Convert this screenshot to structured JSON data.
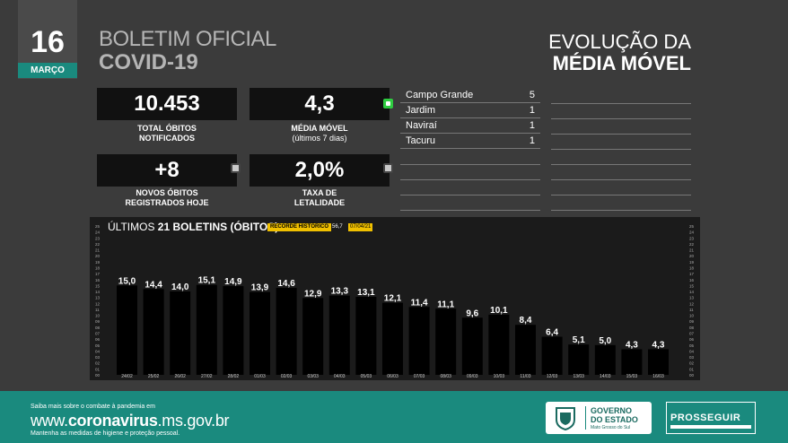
{
  "header": {
    "day": "16",
    "month": "MARÇO",
    "title_line1": "BOLETIM OFICIAL",
    "title_line2": "COVID-19",
    "evo_line1": "EVOLUÇÃO DA",
    "evo_line2": "MÉDIA MÓVEL"
  },
  "stats": {
    "total_obitos": {
      "value": "10.453",
      "label1": "TOTAL ÓBITOS",
      "label2": "NOTIFICADOS"
    },
    "media_movel": {
      "value": "4,3",
      "label1": "MÉDIA MÓVEL",
      "label2": "(últimos 7 dias)",
      "indicator": "green"
    },
    "novos_obitos": {
      "value": "+8",
      "label1": "NOVOS ÓBITOS",
      "label2": "REGISTRADOS HOJE",
      "indicator": "grey"
    },
    "letalidade": {
      "value": "2,0%",
      "label1": "TAXA DE",
      "label2": "LETALIDADE",
      "indicator": "grey"
    }
  },
  "cities": [
    {
      "name": "Campo Grande",
      "value": "5"
    },
    {
      "name": "Jardim",
      "value": "1"
    },
    {
      "name": "Naviraí",
      "value": "1"
    },
    {
      "name": "Tacuru",
      "value": "1"
    }
  ],
  "chart_header": {
    "title_pre": "ÚLTIMOS ",
    "title_bold": "21 BOLETINS (ÓBITOS)",
    "record_label": "RECORDE HISTÓRICO",
    "record_value": "56,7",
    "record_date": "07/04/21"
  },
  "chart_data": {
    "type": "bar",
    "title": "ÚLTIMOS 21 BOLETINS (ÓBITOS)",
    "categories": [
      "24/02",
      "25/02",
      "26/02",
      "27/02",
      "28/02",
      "01/03",
      "02/03",
      "03/03",
      "04/03",
      "05/03",
      "06/03",
      "07/03",
      "08/03",
      "09/03",
      "10/03",
      "11/03",
      "12/03",
      "13/03",
      "14/03",
      "15/03",
      "16/03"
    ],
    "values": [
      15.0,
      14.4,
      14.0,
      15.1,
      14.9,
      13.9,
      14.6,
      12.9,
      13.3,
      13.1,
      12.1,
      11.4,
      11.1,
      9.6,
      10.1,
      8.4,
      6.4,
      5.1,
      5.0,
      4.3,
      4.3
    ],
    "labels": [
      "15,0",
      "14,4",
      "14,0",
      "15,1",
      "14,9",
      "13,9",
      "14,6",
      "12,9",
      "13,3",
      "13,1",
      "12,1",
      "11,4",
      "11,1",
      "9,6",
      "10,1",
      "8,4",
      "6,4",
      "5,1",
      "5,0",
      "4,3",
      "4,3"
    ],
    "ylim": [
      0,
      25
    ],
    "yticks": [
      "25",
      "24",
      "23",
      "22",
      "21",
      "20",
      "19",
      "18",
      "17",
      "16",
      "15",
      "14",
      "13",
      "12",
      "11",
      "10",
      "09",
      "08",
      "07",
      "06",
      "05",
      "04",
      "03",
      "02",
      "01",
      "00"
    ],
    "bar_color": "#000000",
    "grid": false
  },
  "footer": {
    "small1": "Saiba mais sobre o combate à pandemia em",
    "url_pre": "www.",
    "url_bold": "coronavirus",
    "url_post": ".ms.gov.br",
    "small2": "Mantenha as medidas de higiene e proteção pessoal.",
    "gov_line1": "GOVERNO",
    "gov_line2": "DO ESTADO",
    "gov_line3": "Mato Grosso do Sul",
    "prosseguir": "PROSSEGUIR"
  }
}
